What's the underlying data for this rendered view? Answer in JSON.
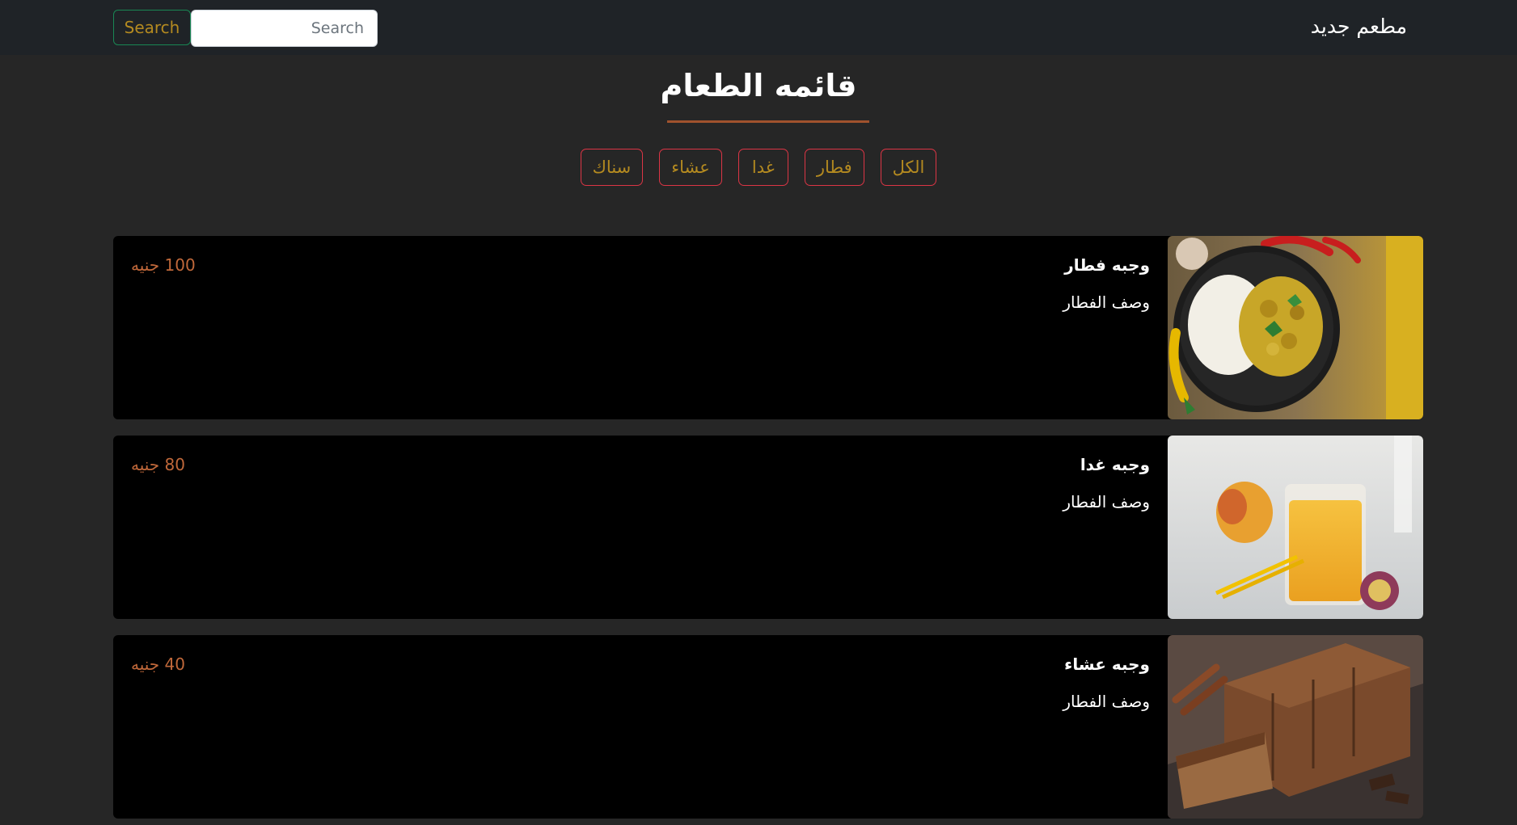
{
  "navbar": {
    "brand": "مطعم جديد",
    "search_placeholder": "Search",
    "search_button": "Search"
  },
  "menu": {
    "title": "قائمه الطعام",
    "filters": [
      "الكل",
      "فطار",
      "غدا",
      "عشاء",
      "سناك"
    ]
  },
  "items": [
    {
      "name": "وجبه فطار",
      "description": "وصف الفطار",
      "price": "100 جنيه",
      "image": "curry-rice-bowl"
    },
    {
      "name": "وجبه غدا",
      "description": "وصف الفطار",
      "price": "80 جنيه",
      "image": "mango-juice-glass"
    },
    {
      "name": "وجبه عشاء",
      "description": "وصف الفطار",
      "price": "40 جنيه",
      "image": "chocolate-loaf-cake"
    }
  ],
  "colors": {
    "navbar_bg": "#1f2327",
    "page_bg": "#262626",
    "card_bg": "#000000",
    "accent_gold": "#b48a20",
    "filter_border": "#dc3545",
    "price": "#c0683a",
    "underline": "#a0522d",
    "search_button_border": "#198754"
  }
}
